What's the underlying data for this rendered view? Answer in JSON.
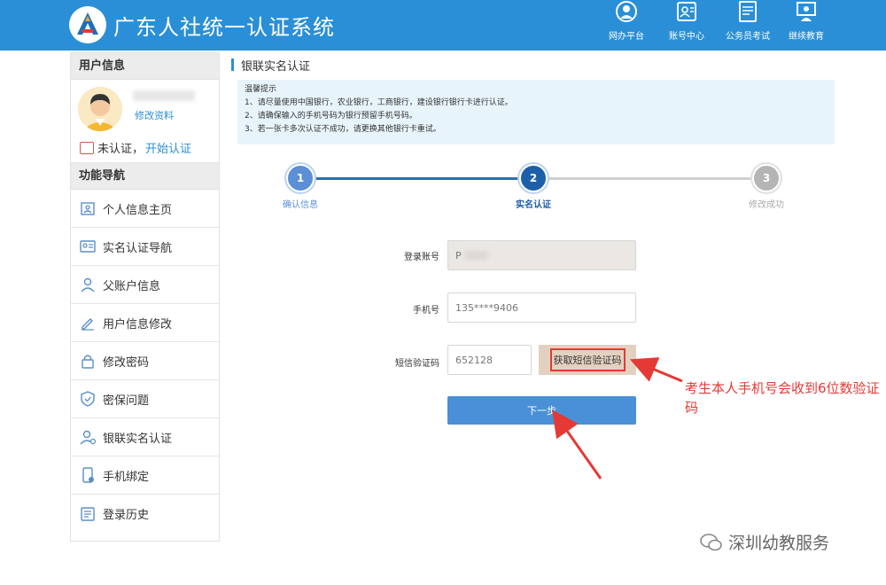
{
  "header": {
    "title": "广东人社统一认证系统",
    "nav": [
      {
        "label": "网办平台",
        "icon": "person-badge-icon"
      },
      {
        "label": "账号中心",
        "icon": "id-card-icon"
      },
      {
        "label": "公务员考试",
        "icon": "exam-sheet-icon"
      },
      {
        "label": "继续教育",
        "icon": "teacher-board-icon"
      }
    ],
    "brand_color": "#2a8fd6"
  },
  "sidebar": {
    "user_section_title": "用户信息",
    "edit_profile": "修改资料",
    "unverified": "未认证，",
    "start_verify": "开始认证",
    "nav_section_title": "功能导航",
    "items": [
      {
        "label": "个人信息主页",
        "icon": "profile-page-icon"
      },
      {
        "label": "实名认证导航",
        "icon": "id-card-icon"
      },
      {
        "label": "父账户信息",
        "icon": "user-icon"
      },
      {
        "label": "用户信息修改",
        "icon": "pencil-icon"
      },
      {
        "label": "修改密码",
        "icon": "lock-icon"
      },
      {
        "label": "密保问题",
        "icon": "shield-icon"
      },
      {
        "label": "银联实名认证",
        "icon": "user-verify-icon"
      },
      {
        "label": "手机绑定",
        "icon": "phone-icon"
      },
      {
        "label": "登录历史",
        "icon": "history-list-icon"
      }
    ]
  },
  "main": {
    "title": "银联实名认证",
    "tips": {
      "heading": "温馨提示",
      "lines": [
        "1、请尽量使用中国银行，农业银行，工商银行，建设银行银行卡进行认证。",
        "2、请确保输入的手机号码为银行预留手机号码。",
        "3、若一张卡多次认证不成功，请更换其他银行卡重试。"
      ]
    },
    "steps": [
      {
        "num": "1",
        "label": "确认信息",
        "state": "done"
      },
      {
        "num": "2",
        "label": "实名认证",
        "state": "active"
      },
      {
        "num": "3",
        "label": "修改成功",
        "state": "pending"
      }
    ],
    "form": {
      "account_label": "登录账号",
      "account_value": "P",
      "phone_label": "手机号",
      "phone_value": "135****9406",
      "sms_label": "短信验证码",
      "sms_value": "652128",
      "sms_button": "获取短信验证码",
      "next_button": "下一步"
    }
  },
  "annotation": "考生本人手机号会收到6位数验证码",
  "watermark": "深圳幼教服务"
}
